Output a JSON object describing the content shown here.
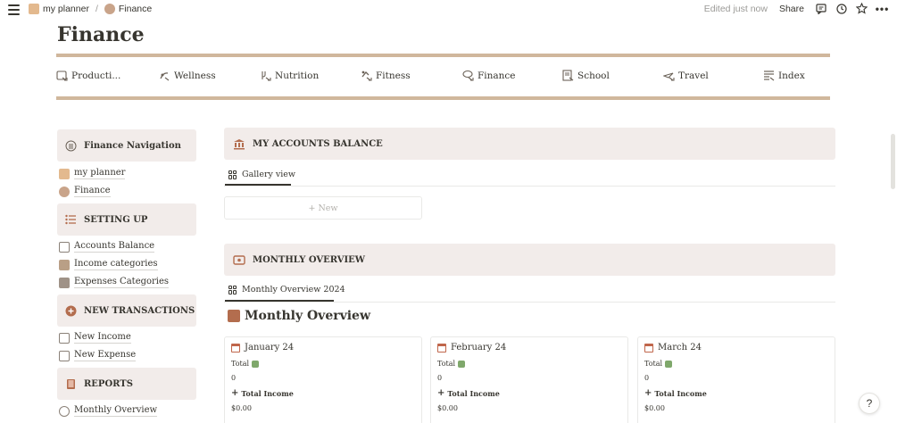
{
  "topbar": {
    "breadcrumbs": [
      "my planner",
      "Finance"
    ],
    "separator": "/",
    "edited": "Edited just now",
    "share": "Share"
  },
  "page": {
    "title": "Finance"
  },
  "nav": [
    {
      "label": "Producti...",
      "icon": "productivity-icon"
    },
    {
      "label": "Wellness",
      "icon": "wellness-icon"
    },
    {
      "label": "Nutrition",
      "icon": "nutrition-icon"
    },
    {
      "label": "Fitness",
      "icon": "fitness-icon"
    },
    {
      "label": "Finance",
      "icon": "finance-icon"
    },
    {
      "label": "School",
      "icon": "school-icon"
    },
    {
      "label": "Travel",
      "icon": "travel-icon"
    },
    {
      "label": "Index",
      "icon": "index-icon"
    }
  ],
  "sidebar": {
    "finance_navigation": "Finance Navigation",
    "nav_links": [
      "my planner",
      "Finance"
    ],
    "setting_up": "SETTING UP",
    "setup_links": [
      "Accounts Balance",
      "Income categories",
      "Expenses Categories"
    ],
    "new_transactions": "NEW TRANSACTIONS",
    "transaction_links": [
      "New Income",
      "New Expense"
    ],
    "reports": "REPORTS",
    "report_links": [
      "Monthly Overview"
    ]
  },
  "accounts": {
    "heading": "MY ACCOUNTS BALANCE",
    "view_tab": "Gallery view",
    "new_label": "+ New"
  },
  "monthly": {
    "heading": "MONTHLY OVERVIEW",
    "view_tab": "Monthly Overview 2024",
    "title": "Monthly Overview",
    "cards": [
      {
        "title": "January 24",
        "total_label": "Total",
        "total_value": "0",
        "income_label": "Total Income",
        "income_value": "$0.00"
      },
      {
        "title": "February 24",
        "total_label": "Total",
        "total_value": "0",
        "income_label": "Total Income",
        "income_value": "$0.00"
      },
      {
        "title": "March 24",
        "total_label": "Total",
        "total_value": "0",
        "income_label": "Total Income",
        "income_value": "$0.00"
      }
    ]
  },
  "help": "?",
  "colors": {
    "accent_rule": "#d0b79c",
    "block_bg": "#f2ecea",
    "text": "#37352f"
  }
}
